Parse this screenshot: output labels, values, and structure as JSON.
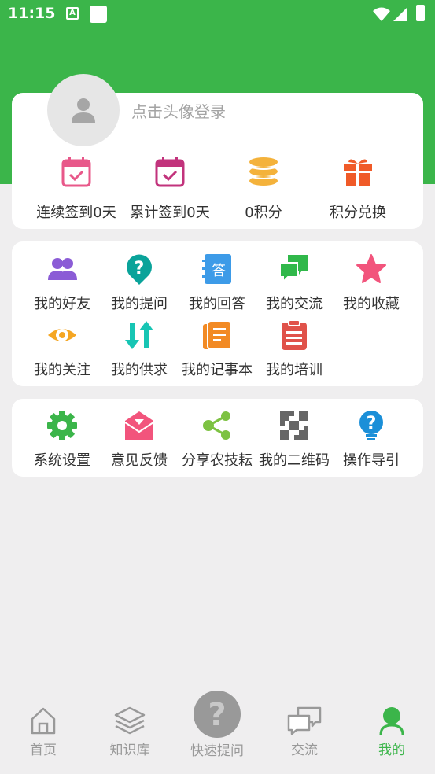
{
  "status_bar": {
    "time": "11:15",
    "a_icon": "A"
  },
  "profile": {
    "login_prompt": "点击头像登录"
  },
  "stats": [
    {
      "label": "连续签到0天",
      "icon": "calendar-check-icon",
      "color": "#e8588a"
    },
    {
      "label": "累计签到0天",
      "icon": "calendar-check-icon",
      "color": "#c2337c"
    },
    {
      "label": "0积分",
      "icon": "coins-icon",
      "color": "#f4b23b"
    },
    {
      "label": "积分兑换",
      "icon": "gift-icon",
      "color": "#f05a28"
    }
  ],
  "menu": [
    {
      "label": "我的好友",
      "icon": "friends-icon",
      "color": "#8b5cd6"
    },
    {
      "label": "我的提问",
      "icon": "question-pin-icon",
      "color": "#0aa39a"
    },
    {
      "label": "我的回答",
      "icon": "answer-notebook-icon",
      "color": "#3d9be8",
      "glyph": "答"
    },
    {
      "label": "我的交流",
      "icon": "chat-bubbles-icon",
      "color": "#30b84a"
    },
    {
      "label": "我的收藏",
      "icon": "star-icon",
      "color": "#f2547c"
    },
    {
      "label": "我的关注",
      "icon": "eye-icon",
      "color": "#f5a623"
    },
    {
      "label": "我的供求",
      "icon": "supply-demand-arrows-icon",
      "color": "#17c5b4"
    },
    {
      "label": "我的记事本",
      "icon": "notes-icon",
      "color": "#f28a24"
    },
    {
      "label": "我的培训",
      "icon": "clipboard-icon",
      "color": "#e0524a"
    }
  ],
  "tools": [
    {
      "label": "系统设置",
      "icon": "gear-icon",
      "color": "#3bb54a"
    },
    {
      "label": "意见反馈",
      "icon": "mail-icon",
      "color": "#f2547c"
    },
    {
      "label": "分享农技耘",
      "icon": "share-icon",
      "color": "#7dc242"
    },
    {
      "label": "我的二维码",
      "icon": "qrcode-icon",
      "color": "#666666"
    },
    {
      "label": "操作导引",
      "icon": "help-bulb-icon",
      "color": "#1b8fd8"
    }
  ],
  "tabbar": [
    {
      "label": "首页",
      "icon": "home-icon"
    },
    {
      "label": "知识库",
      "icon": "layers-icon"
    },
    {
      "label": "快速提问",
      "icon": "question-fab-icon"
    },
    {
      "label": "交流",
      "icon": "chat-icon"
    },
    {
      "label": "我的",
      "icon": "person-icon",
      "active": true
    }
  ],
  "colors": {
    "brand": "#3bb54a",
    "background": "#efeeef",
    "inactive": "#999999"
  }
}
